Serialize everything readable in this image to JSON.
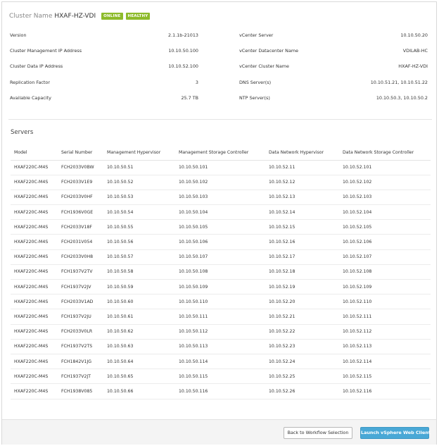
{
  "header": {
    "cluster_name_label": "Cluster Name",
    "cluster_name_value": "HXAF-HZ-VDI",
    "badges": [
      "ONLINE",
      "HEALTHY"
    ]
  },
  "properties": {
    "left": [
      {
        "label": "Version",
        "value": "2.1.1b-21013"
      },
      {
        "label": "Cluster Management IP Address",
        "value": "10.10.50.100"
      },
      {
        "label": "Cluster Data IP Address",
        "value": "10.10.52.100"
      },
      {
        "label": "Replication Factor",
        "value": "3"
      },
      {
        "label": "Available Capacity",
        "value": "25.7 TB"
      }
    ],
    "right": [
      {
        "label": "vCenter Server",
        "value": "10.10.50.20"
      },
      {
        "label": "vCenter Datacenter Name",
        "value": "VDILAB-HC"
      },
      {
        "label": "vCenter Cluster Name",
        "value": "HXAF-HZ-VDI"
      },
      {
        "label": "DNS Server(s)",
        "value": "10.10.51.21, 10.10.51.22"
      },
      {
        "label": "NTP Server(s)",
        "value": "10.10.50.3, 10.10.50.2"
      }
    ]
  },
  "servers": {
    "title": "Servers",
    "columns": [
      "Model",
      "Serial Number",
      "Management Hypervisor",
      "Management Storage Controller",
      "Data Network Hypervisor",
      "Data Network Storage Controller"
    ],
    "rows": [
      [
        "HXAF220C-M4S",
        "FCH2033V0BW",
        "10.10.50.51",
        "10.10.50.101",
        "10.10.52.11",
        "10.10.52.101"
      ],
      [
        "HXAF220C-M4S",
        "FCH2033V1E9",
        "10.10.50.52",
        "10.10.50.102",
        "10.10.52.12",
        "10.10.52.102"
      ],
      [
        "HXAF220C-M4S",
        "FCH2033V0HF",
        "10.10.50.53",
        "10.10.50.103",
        "10.10.52.13",
        "10.10.52.103"
      ],
      [
        "HXAF220C-M4S",
        "FCH1936V0GE",
        "10.10.50.54",
        "10.10.50.104",
        "10.10.52.14",
        "10.10.52.104"
      ],
      [
        "HXAF220C-M4S",
        "FCH2033V18F",
        "10.10.50.55",
        "10.10.50.105",
        "10.10.52.15",
        "10.10.52.105"
      ],
      [
        "HXAF220C-M4S",
        "FCH2031V054",
        "10.10.50.56",
        "10.10.50.106",
        "10.10.52.16",
        "10.10.52.106"
      ],
      [
        "HXAF220C-M4S",
        "FCH2033V0H8",
        "10.10.50.57",
        "10.10.50.107",
        "10.10.52.17",
        "10.10.52.107"
      ],
      [
        "HXAF220C-M4S",
        "FCH1937V2TV",
        "10.10.50.58",
        "10.10.50.108",
        "10.10.52.18",
        "10.10.52.108"
      ],
      [
        "HXAF220C-M4S",
        "FCH1937V2JV",
        "10.10.50.59",
        "10.10.50.109",
        "10.10.52.19",
        "10.10.52.109"
      ],
      [
        "HXAF220C-M4S",
        "FCH2033V1AD",
        "10.10.50.60",
        "10.10.50.110",
        "10.10.52.20",
        "10.10.52.110"
      ],
      [
        "HXAF220C-M4S",
        "FCH1937V2JU",
        "10.10.50.61",
        "10.10.50.111",
        "10.10.52.21",
        "10.10.52.111"
      ],
      [
        "HXAF220C-M4S",
        "FCH2033V0LR",
        "10.10.50.62",
        "10.10.50.112",
        "10.10.52.22",
        "10.10.52.112"
      ],
      [
        "HXAF220C-M4S",
        "FCH1937V2TS",
        "10.10.50.63",
        "10.10.50.113",
        "10.10.52.23",
        "10.10.52.113"
      ],
      [
        "HXAF220C-M4S",
        "FCH1842V1JG",
        "10.10.50.64",
        "10.10.50.114",
        "10.10.52.24",
        "10.10.52.114"
      ],
      [
        "HXAF220C-M4S",
        "FCH1937V2JT",
        "10.10.50.65",
        "10.10.50.115",
        "10.10.52.25",
        "10.10.52.115"
      ],
      [
        "HXAF220C-M4S",
        "FCH1938V085",
        "10.10.50.66",
        "10.10.50.116",
        "10.10.52.26",
        "10.10.52.116"
      ]
    ]
  },
  "footer": {
    "back_label": "Back to Workflow Selection",
    "launch_label": "Launch vSphere Web Client"
  },
  "colors": {
    "badge": "#8dbb2b",
    "primary_button": "#49a8d6"
  }
}
